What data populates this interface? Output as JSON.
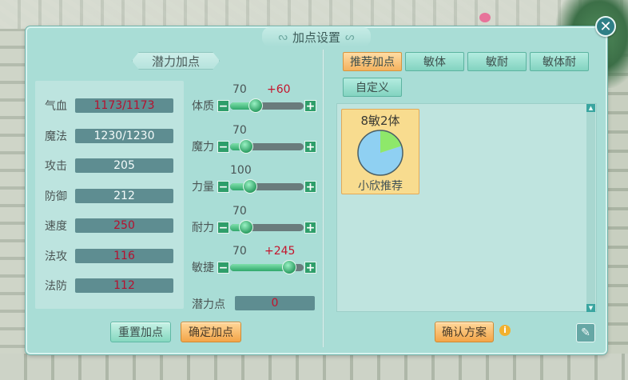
{
  "window": {
    "title": "加点设置",
    "close_icon": "close-icon"
  },
  "left": {
    "section_title": "潜力加点",
    "stats": [
      {
        "name": "气血",
        "value": "1173/1173",
        "color": "#b7102f"
      },
      {
        "name": "魔法",
        "value": "1230/1230",
        "color": "#f4fbfa"
      },
      {
        "name": "攻击",
        "value": "205",
        "color": "#f4fbfa"
      },
      {
        "name": "防御",
        "value": "212",
        "color": "#f4fbfa"
      },
      {
        "name": "速度",
        "value": "250",
        "color": "#b7102f"
      },
      {
        "name": "法攻",
        "value": "116",
        "color": "#b7102f"
      },
      {
        "name": "法防",
        "value": "112",
        "color": "#b7102f"
      }
    ],
    "attributes": [
      {
        "name": "体质",
        "base": "70",
        "bonus": "+60",
        "level": 0.35
      },
      {
        "name": "魔力",
        "base": "70",
        "bonus": "",
        "level": 0.22
      },
      {
        "name": "力量",
        "base": "100",
        "bonus": "",
        "level": 0.27
      },
      {
        "name": "耐力",
        "base": "70",
        "bonus": "",
        "level": 0.22
      },
      {
        "name": "敏捷",
        "base": "70",
        "bonus": "+245",
        "level": 0.8
      }
    ],
    "potential_label": "潜力点",
    "potential_value": "0",
    "reset_button": "重置加点",
    "confirm_button": "确定加点"
  },
  "right": {
    "tabs": [
      {
        "label": "推荐加点",
        "active": true
      },
      {
        "label": "敏体",
        "active": false
      },
      {
        "label": "敏耐",
        "active": false
      },
      {
        "label": "敏体耐",
        "active": false
      },
      {
        "label": "自定义",
        "active": false
      }
    ],
    "plans": [
      {
        "title": "8敏2体",
        "subtitle": "小欣推荐",
        "pie": [
          {
            "part": "敏",
            "value": 8,
            "color": "#8fd0f2"
          },
          {
            "part": "体",
            "value": 2,
            "color": "#8ee86a"
          }
        ]
      }
    ],
    "confirm_plan_button": "确认方案",
    "info_icon": "info-icon",
    "notes_icon": "edit-notes-icon"
  },
  "colors": {
    "panel": "#a9ddd6",
    "accent_orange": "#f3a548",
    "accent_teal": "#86d8c0",
    "bonus_red": "#c4142c"
  }
}
